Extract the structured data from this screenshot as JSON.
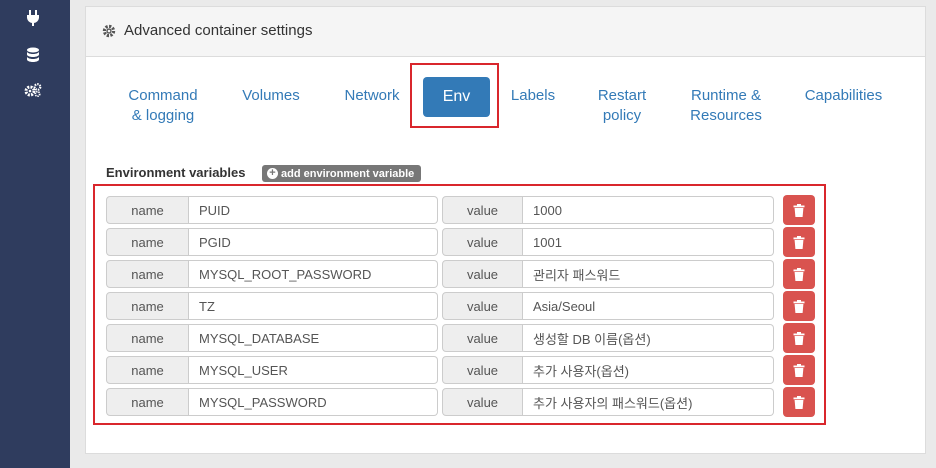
{
  "sidebar": {
    "icons": [
      "plug-icon",
      "database-icon",
      "cogs-icon"
    ]
  },
  "panel": {
    "title": "Advanced container settings"
  },
  "tabs": [
    {
      "label": "Command\n& logging",
      "active": false
    },
    {
      "label": "Volumes",
      "active": false
    },
    {
      "label": "Network",
      "active": false
    },
    {
      "label": "Env",
      "active": true
    },
    {
      "label": "Labels",
      "active": false
    },
    {
      "label": "Restart\npolicy",
      "active": false
    },
    {
      "label": "Runtime &\nResources",
      "active": false
    },
    {
      "label": "Capabilities",
      "active": false
    }
  ],
  "env": {
    "heading": "Environment variables",
    "add_button_label": "add environment variable",
    "name_addon": "name",
    "value_addon": "value",
    "rows": [
      {
        "name": "PUID",
        "value": "1000"
      },
      {
        "name": "PGID",
        "value": "1001"
      },
      {
        "name": "MYSQL_ROOT_PASSWORD",
        "value": "관리자 패스워드"
      },
      {
        "name": "TZ",
        "value": "Asia/Seoul"
      },
      {
        "name": "MYSQL_DATABASE",
        "value": "생성할 DB 이름(옵션)"
      },
      {
        "name": "MYSQL_USER",
        "value": "추가 사용자(옵션)"
      },
      {
        "name": "MYSQL_PASSWORD",
        "value": "추가 사용자의 패스워드(옵션)"
      }
    ]
  },
  "colors": {
    "sidebar": "#2f3c5e",
    "link": "#337ab7",
    "danger": "#d9534f",
    "highlight": "#d9262c"
  }
}
